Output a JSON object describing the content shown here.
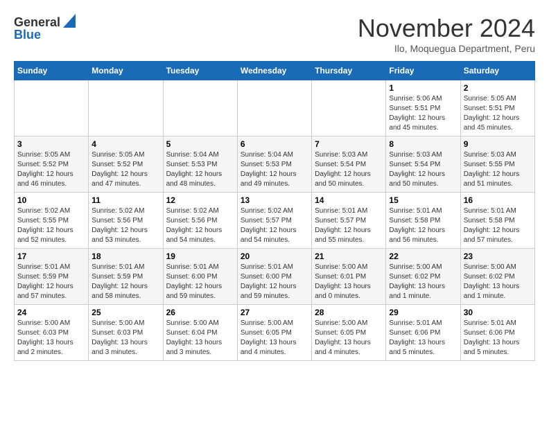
{
  "header": {
    "logo_general": "General",
    "logo_blue": "Blue",
    "month_title": "November 2024",
    "location": "Ilo, Moquegua Department, Peru"
  },
  "calendar": {
    "days_of_week": [
      "Sunday",
      "Monday",
      "Tuesday",
      "Wednesday",
      "Thursday",
      "Friday",
      "Saturday"
    ],
    "weeks": [
      [
        {
          "day": "",
          "info": ""
        },
        {
          "day": "",
          "info": ""
        },
        {
          "day": "",
          "info": ""
        },
        {
          "day": "",
          "info": ""
        },
        {
          "day": "",
          "info": ""
        },
        {
          "day": "1",
          "info": "Sunrise: 5:06 AM\nSunset: 5:51 PM\nDaylight: 12 hours\nand 45 minutes."
        },
        {
          "day": "2",
          "info": "Sunrise: 5:05 AM\nSunset: 5:51 PM\nDaylight: 12 hours\nand 45 minutes."
        }
      ],
      [
        {
          "day": "3",
          "info": "Sunrise: 5:05 AM\nSunset: 5:52 PM\nDaylight: 12 hours\nand 46 minutes."
        },
        {
          "day": "4",
          "info": "Sunrise: 5:05 AM\nSunset: 5:52 PM\nDaylight: 12 hours\nand 47 minutes."
        },
        {
          "day": "5",
          "info": "Sunrise: 5:04 AM\nSunset: 5:53 PM\nDaylight: 12 hours\nand 48 minutes."
        },
        {
          "day": "6",
          "info": "Sunrise: 5:04 AM\nSunset: 5:53 PM\nDaylight: 12 hours\nand 49 minutes."
        },
        {
          "day": "7",
          "info": "Sunrise: 5:03 AM\nSunset: 5:54 PM\nDaylight: 12 hours\nand 50 minutes."
        },
        {
          "day": "8",
          "info": "Sunrise: 5:03 AM\nSunset: 5:54 PM\nDaylight: 12 hours\nand 50 minutes."
        },
        {
          "day": "9",
          "info": "Sunrise: 5:03 AM\nSunset: 5:55 PM\nDaylight: 12 hours\nand 51 minutes."
        }
      ],
      [
        {
          "day": "10",
          "info": "Sunrise: 5:02 AM\nSunset: 5:55 PM\nDaylight: 12 hours\nand 52 minutes."
        },
        {
          "day": "11",
          "info": "Sunrise: 5:02 AM\nSunset: 5:56 PM\nDaylight: 12 hours\nand 53 minutes."
        },
        {
          "day": "12",
          "info": "Sunrise: 5:02 AM\nSunset: 5:56 PM\nDaylight: 12 hours\nand 54 minutes."
        },
        {
          "day": "13",
          "info": "Sunrise: 5:02 AM\nSunset: 5:57 PM\nDaylight: 12 hours\nand 54 minutes."
        },
        {
          "day": "14",
          "info": "Sunrise: 5:01 AM\nSunset: 5:57 PM\nDaylight: 12 hours\nand 55 minutes."
        },
        {
          "day": "15",
          "info": "Sunrise: 5:01 AM\nSunset: 5:58 PM\nDaylight: 12 hours\nand 56 minutes."
        },
        {
          "day": "16",
          "info": "Sunrise: 5:01 AM\nSunset: 5:58 PM\nDaylight: 12 hours\nand 57 minutes."
        }
      ],
      [
        {
          "day": "17",
          "info": "Sunrise: 5:01 AM\nSunset: 5:59 PM\nDaylight: 12 hours\nand 57 minutes."
        },
        {
          "day": "18",
          "info": "Sunrise: 5:01 AM\nSunset: 5:59 PM\nDaylight: 12 hours\nand 58 minutes."
        },
        {
          "day": "19",
          "info": "Sunrise: 5:01 AM\nSunset: 6:00 PM\nDaylight: 12 hours\nand 59 minutes."
        },
        {
          "day": "20",
          "info": "Sunrise: 5:01 AM\nSunset: 6:00 PM\nDaylight: 12 hours\nand 59 minutes."
        },
        {
          "day": "21",
          "info": "Sunrise: 5:00 AM\nSunset: 6:01 PM\nDaylight: 13 hours\nand 0 minutes."
        },
        {
          "day": "22",
          "info": "Sunrise: 5:00 AM\nSunset: 6:02 PM\nDaylight: 13 hours\nand 1 minute."
        },
        {
          "day": "23",
          "info": "Sunrise: 5:00 AM\nSunset: 6:02 PM\nDaylight: 13 hours\nand 1 minute."
        }
      ],
      [
        {
          "day": "24",
          "info": "Sunrise: 5:00 AM\nSunset: 6:03 PM\nDaylight: 13 hours\nand 2 minutes."
        },
        {
          "day": "25",
          "info": "Sunrise: 5:00 AM\nSunset: 6:03 PM\nDaylight: 13 hours\nand 3 minutes."
        },
        {
          "day": "26",
          "info": "Sunrise: 5:00 AM\nSunset: 6:04 PM\nDaylight: 13 hours\nand 3 minutes."
        },
        {
          "day": "27",
          "info": "Sunrise: 5:00 AM\nSunset: 6:05 PM\nDaylight: 13 hours\nand 4 minutes."
        },
        {
          "day": "28",
          "info": "Sunrise: 5:00 AM\nSunset: 6:05 PM\nDaylight: 13 hours\nand 4 minutes."
        },
        {
          "day": "29",
          "info": "Sunrise: 5:01 AM\nSunset: 6:06 PM\nDaylight: 13 hours\nand 5 minutes."
        },
        {
          "day": "30",
          "info": "Sunrise: 5:01 AM\nSunset: 6:06 PM\nDaylight: 13 hours\nand 5 minutes."
        }
      ]
    ]
  }
}
